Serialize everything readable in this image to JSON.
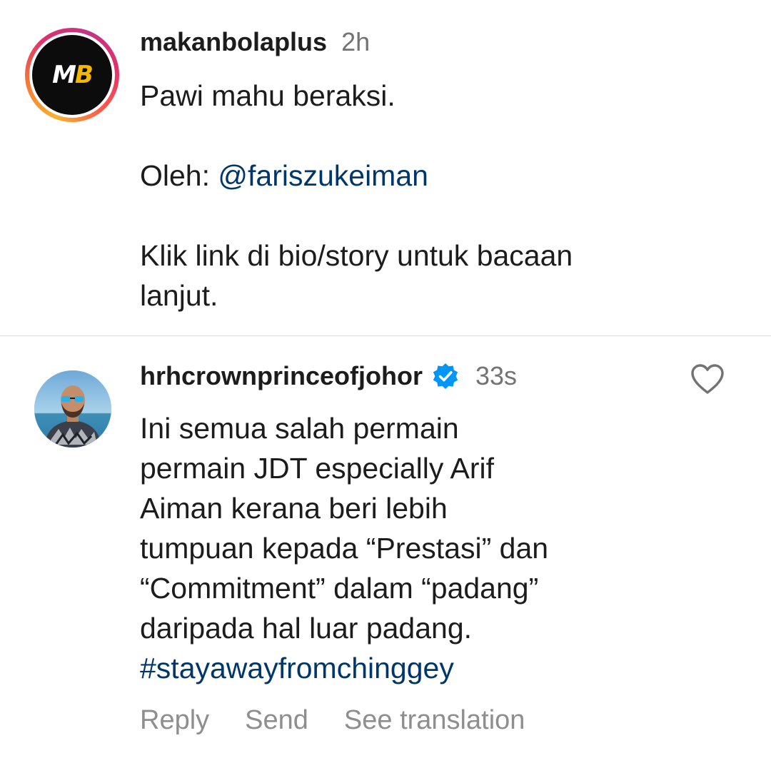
{
  "caption": {
    "username": "makanbolaplus",
    "timestamp": "2h",
    "avatar_logo": {
      "m": "M",
      "b": "B"
    },
    "line1": "Pawi mahu beraksi.",
    "credit_prefix": "Oleh: ",
    "credit_mention": "@fariszukeiman",
    "line3a": "Klik link di bio/story untuk bacaan",
    "line3b": "lanjut."
  },
  "comment": {
    "username": "hrhcrownprinceofjohor",
    "verified": true,
    "timestamp": "33s",
    "lines": [
      "Ini semua salah permain",
      "permain JDT especially Arif",
      "Aiman kerana beri lebih",
      "tumpuan kepada “Prestasi” dan",
      "“Commitment” dalam “padang”",
      "daripada hal luar padang."
    ],
    "hashtag": "#stayawayfromchinggey",
    "actions": {
      "reply": "Reply",
      "send": "Send",
      "translate": "See translation"
    }
  },
  "colors": {
    "link": "#00376b",
    "secondary_text": "#737373",
    "action_text": "#8e8e8e",
    "verified_badge": "#0095f6",
    "divider": "#dbdbdb"
  },
  "icons": {
    "like": "heart-outline-icon",
    "verified": "verified-badge-icon"
  }
}
